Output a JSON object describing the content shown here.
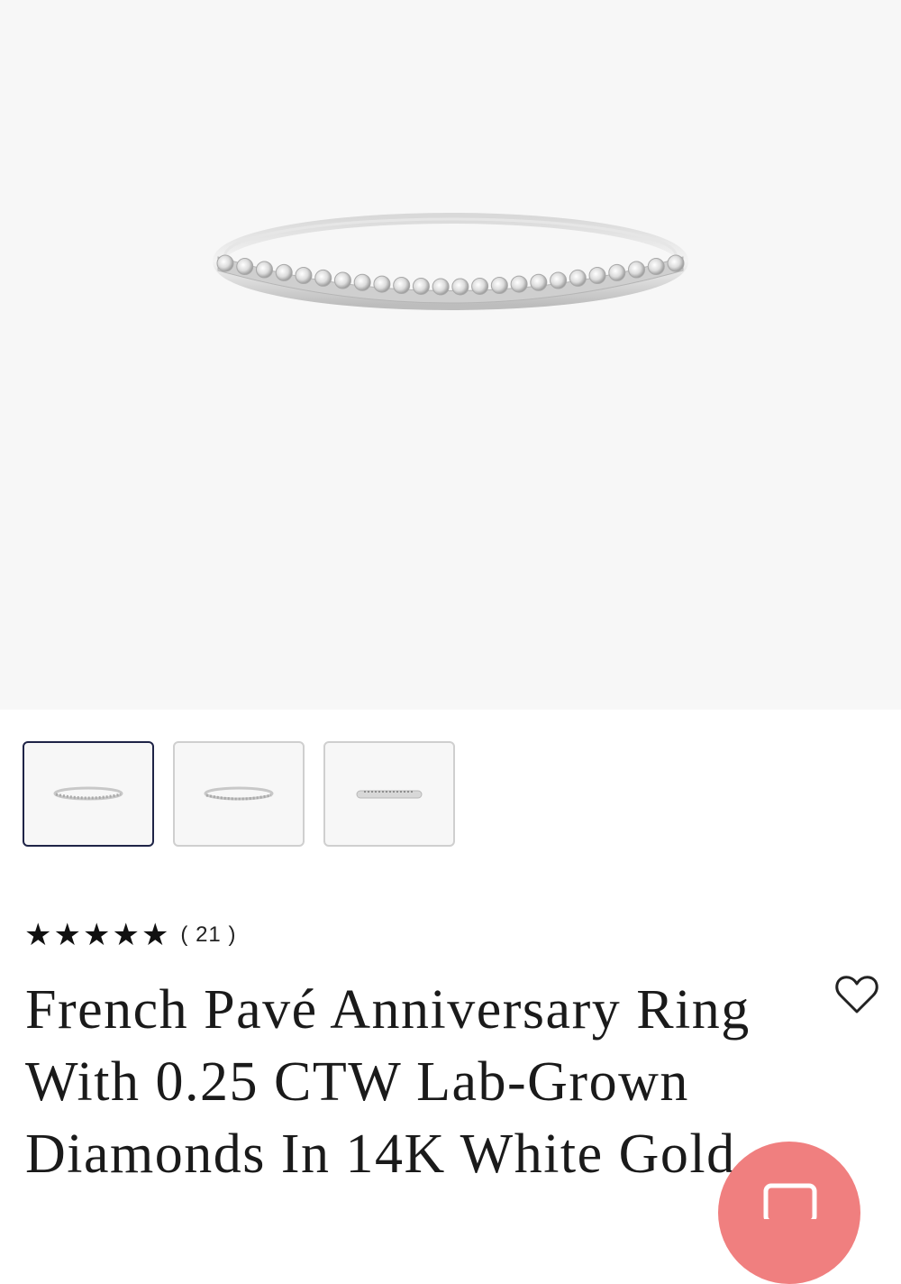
{
  "product": {
    "title_lines": [
      "French Pavé Anniversary Ring",
      "With 0.25 CTW Lab-Grown",
      "Diamonds In 14K White Gold"
    ],
    "rating": {
      "stars": 5,
      "count_text": "( 21 )"
    }
  },
  "gallery": {
    "main_image_alt": "French Pavé Anniversary Ring",
    "thumbnails": [
      {
        "name": "front",
        "selected": true
      },
      {
        "name": "angle",
        "selected": false
      },
      {
        "name": "side",
        "selected": false
      }
    ]
  },
  "icons": {
    "star": "star-icon",
    "wishlist": "heart-icon",
    "chat": "chat-icon"
  },
  "colors": {
    "hero_bg": "#f7f7f7",
    "thumb_selected_border": "#1f2447",
    "chat_button": "#f07f7f",
    "text": "#1a1a1a"
  }
}
